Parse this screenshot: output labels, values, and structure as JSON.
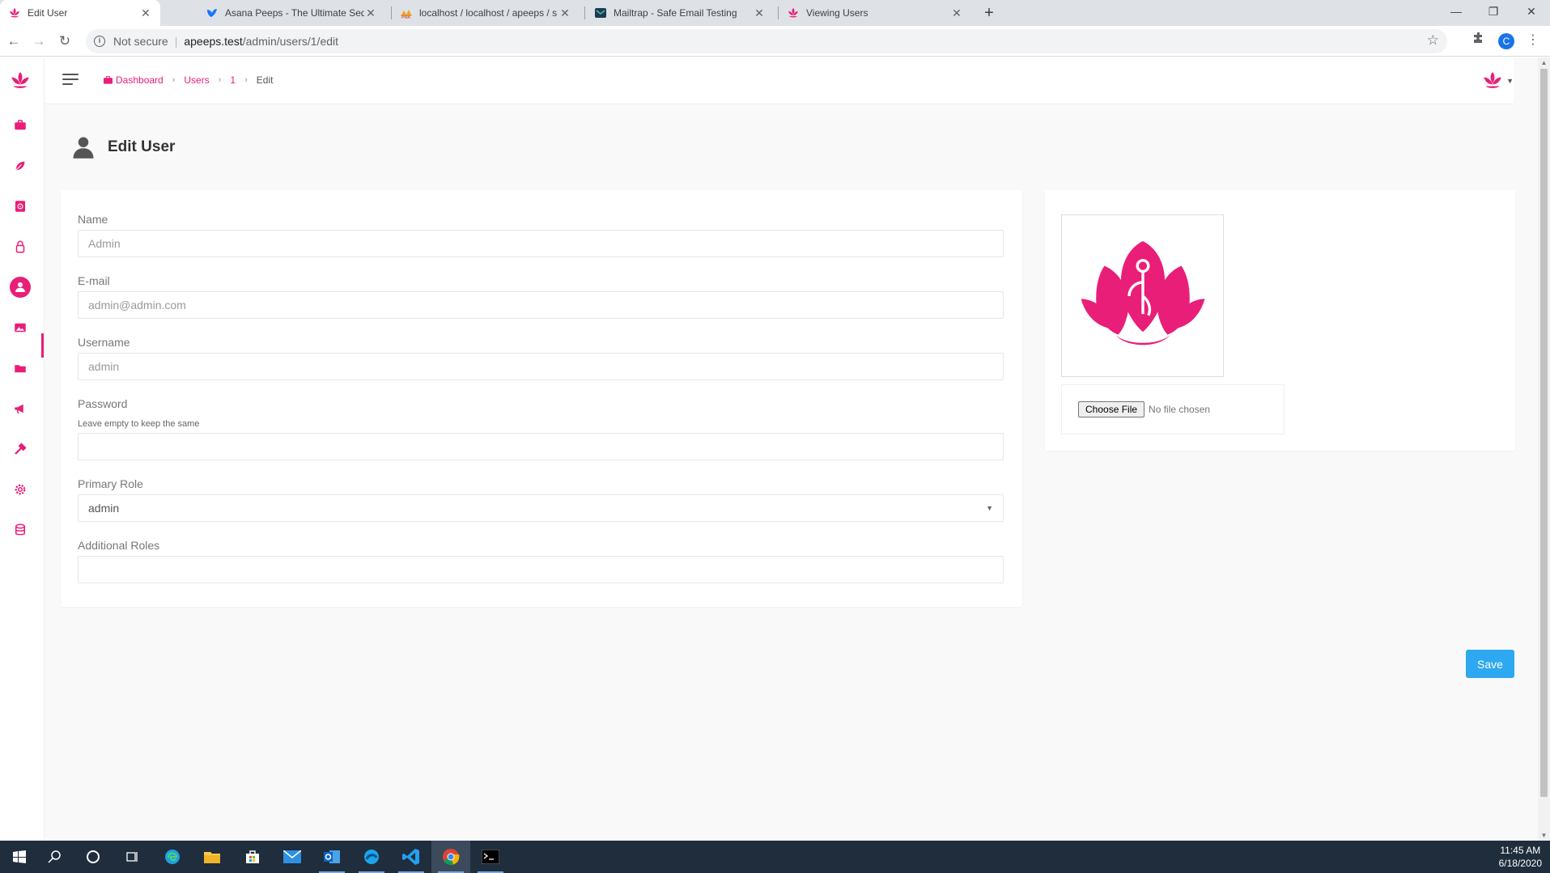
{
  "browser": {
    "tabs": [
      {
        "title": "Edit User",
        "icon": "lotus-favicon",
        "active": true
      },
      {
        "title": "Asana Peeps - The Ultimate Sequ",
        "icon": "bird-favicon"
      },
      {
        "title": "localhost / localhost / apeeps / s",
        "icon": "phpmyadmin-favicon"
      },
      {
        "title": "Mailtrap - Safe Email Testing",
        "icon": "mailtrap-favicon"
      },
      {
        "title": "Viewing Users",
        "icon": "lotus-favicon"
      }
    ],
    "address": {
      "security_label": "Not secure",
      "host": "apeeps.test",
      "path": "/admin/users/1/edit"
    },
    "profile_initial": "C"
  },
  "breadcrumb": [
    "Dashboard",
    "Users",
    "1",
    "Edit"
  ],
  "page": {
    "title": "Edit User"
  },
  "form": {
    "name": {
      "label": "Name",
      "value": "Admin"
    },
    "email": {
      "label": "E-mail",
      "value": "admin@admin.com"
    },
    "username": {
      "label": "Username",
      "value": "admin"
    },
    "password": {
      "label": "Password",
      "hint": "Leave empty to keep the same",
      "value": ""
    },
    "primary_role": {
      "label": "Primary Role",
      "selected": "admin"
    },
    "additional_roles": {
      "label": "Additional Roles",
      "value": ""
    }
  },
  "avatar_upload": {
    "button_label": "Choose File",
    "status": "No file chosen"
  },
  "save_label": "Save",
  "taskbar": {
    "time": "11:45 AM",
    "date": "6/18/2020"
  },
  "colors": {
    "brand": "#e91e78",
    "save": "#2ea8f0"
  }
}
